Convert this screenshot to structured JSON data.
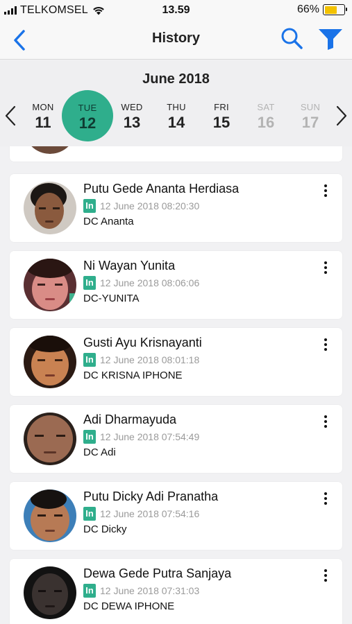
{
  "status_bar": {
    "carrier": "TELKOMSEL",
    "time": "13.59",
    "battery_text": "66%",
    "battery_level": 0.66,
    "battery_color": "#f3c200"
  },
  "nav": {
    "title": "History",
    "back_icon": "chevron-left-icon",
    "search_icon": "search-icon",
    "filter_icon": "filter-icon",
    "accent_color": "#1a73e8"
  },
  "calendar": {
    "month": "June 2018",
    "selected_color": "#2fae8c",
    "days": [
      {
        "name": "MON",
        "date": "11",
        "state": "normal"
      },
      {
        "name": "TUE",
        "date": "12",
        "state": "selected"
      },
      {
        "name": "WED",
        "date": "13",
        "state": "normal"
      },
      {
        "name": "THU",
        "date": "14",
        "state": "normal"
      },
      {
        "name": "FRI",
        "date": "15",
        "state": "normal"
      },
      {
        "name": "SAT",
        "date": "16",
        "state": "muted"
      },
      {
        "name": "SUN",
        "date": "17",
        "state": "muted"
      }
    ]
  },
  "records": [
    {
      "name": "Putu Gede Ananta Herdiasa",
      "badge": "In",
      "timestamp": "12 June 2018 08:20:30",
      "device": "DC Ananta"
    },
    {
      "name": "Ni Wayan Yunita",
      "badge": "In",
      "timestamp": "12 June 2018 08:06:06",
      "device": "DC-YUNITA"
    },
    {
      "name": "Gusti Ayu Krisnayanti",
      "badge": "In",
      "timestamp": "12 June 2018 08:01:18",
      "device": "DC KRISNA IPHONE"
    },
    {
      "name": "Adi Dharmayuda",
      "badge": "In",
      "timestamp": "12 June 2018 07:54:49",
      "device": "DC Adi"
    },
    {
      "name": "Putu Dicky Adi Pranatha",
      "badge": "In",
      "timestamp": "12 June 2018 07:54:16",
      "device": "DC Dicky"
    },
    {
      "name": "Dewa Gede Putra Sanjaya",
      "badge": "In",
      "timestamp": "12 June 2018 07:31:03",
      "device": "DC DEWA IPHONE"
    }
  ]
}
